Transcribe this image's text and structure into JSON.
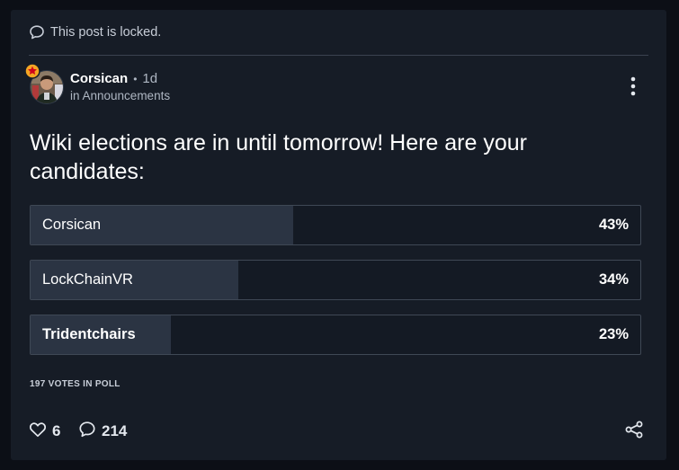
{
  "post": {
    "locked_notice": "This post is locked.",
    "author": "Corsican",
    "separator": "•",
    "age": "1d",
    "community": "in Announcements",
    "title": "Wiki elections are in until tomorrow! Here are your candidates:"
  },
  "poll": {
    "options": [
      {
        "label": "Corsican",
        "percent_text": "43%",
        "percent": 43
      },
      {
        "label": "LockChainVR",
        "percent_text": "34%",
        "percent": 34
      },
      {
        "label": "Tridentchairs",
        "percent_text": "23%",
        "percent": 23
      }
    ],
    "votes_text": "197 VOTES IN POLL"
  },
  "footer": {
    "likes": "6",
    "comments": "214"
  },
  "colors": {
    "card_bg": "#161c26",
    "poll_fill": "#2b3443",
    "badge": "#f5a623"
  }
}
